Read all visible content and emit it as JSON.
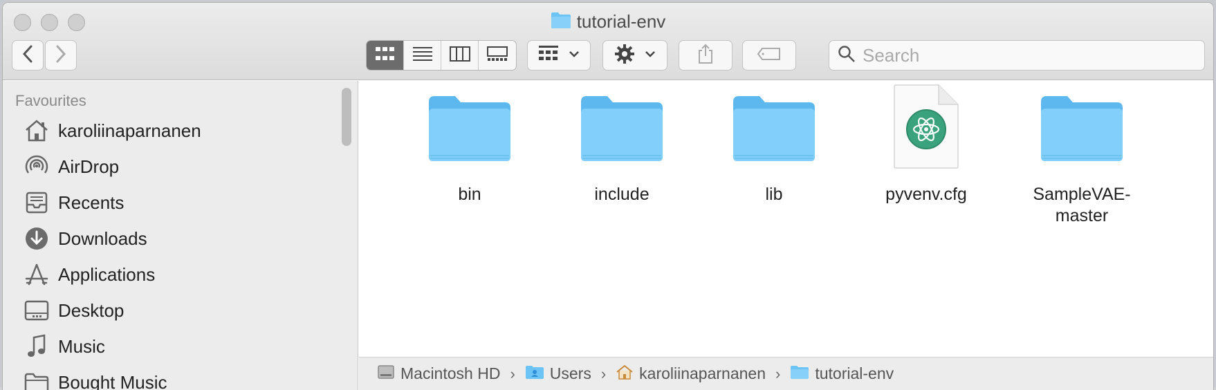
{
  "window": {
    "title": "tutorial-env"
  },
  "toolbar": {
    "search_placeholder": "Search"
  },
  "sidebar": {
    "section": "Favourites",
    "items": [
      {
        "label": "karoliinaparnanen",
        "icon": "home-icon"
      },
      {
        "label": "AirDrop",
        "icon": "airdrop-icon"
      },
      {
        "label": "Recents",
        "icon": "recents-icon"
      },
      {
        "label": "Downloads",
        "icon": "downloads-icon"
      },
      {
        "label": "Applications",
        "icon": "applications-icon"
      },
      {
        "label": "Desktop",
        "icon": "desktop-icon"
      },
      {
        "label": "Music",
        "icon": "music-icon"
      },
      {
        "label": "Bought Music",
        "icon": "folder-icon"
      }
    ]
  },
  "files": [
    {
      "name": "bin",
      "kind": "folder"
    },
    {
      "name": "include",
      "kind": "folder"
    },
    {
      "name": "lib",
      "kind": "folder"
    },
    {
      "name": "pyvenv.cfg",
      "kind": "atom-document"
    },
    {
      "name": "SampleVAE-master",
      "kind": "folder"
    }
  ],
  "pathbar": {
    "crumbs": [
      "Macintosh HD",
      "Users",
      "karoliinaparnanen",
      "tutorial-env"
    ]
  },
  "colors": {
    "folder": "#6cc3f5",
    "accent": "#1f97e8",
    "atom": "#3aa27c"
  }
}
